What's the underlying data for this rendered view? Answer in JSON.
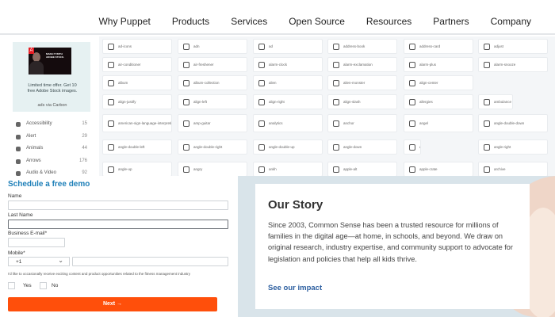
{
  "nav": {
    "items": [
      "Why Puppet",
      "Products",
      "Services",
      "Open Source",
      "Resources",
      "Partners",
      "Company"
    ]
  },
  "ad": {
    "image_caption": "MAKE IT WITH ADOBE STOCK.",
    "logo": "A",
    "text": "Limited time offer. Get 10 free Adobe Stock images.",
    "credit": "ads via Carbon",
    "close": "×"
  },
  "categories": [
    {
      "label": "Accessibility",
      "count": "15"
    },
    {
      "label": "Alert",
      "count": "29"
    },
    {
      "label": "Animals",
      "count": "44"
    },
    {
      "label": "Arrows",
      "count": "176"
    },
    {
      "label": "Audio & Video",
      "count": "92"
    }
  ],
  "icons": [
    "ad-icons",
    "adn",
    "ad",
    "address-book",
    "address-card",
    "adjust",
    "air-conditioner",
    "air-freshener",
    "alarm-clock",
    "alarm-exclamation",
    "alarm-plus",
    "alarm-snooze",
    "album",
    "album-collection",
    "alien",
    "alien-monster",
    "align-center",
    "align-justify",
    "align-left",
    "align-right",
    "align-slash",
    "allergies",
    "ambulance",
    "american-sign-language-interpreting",
    "amp-guitar",
    "analytics",
    "anchor",
    "angel",
    "angle-double-down",
    "angle-double-left",
    "angle-double-right",
    "angle-double-up",
    "angle-down",
    "angle-left",
    "angle-right",
    "angle-up",
    "angry",
    "ankh",
    "apple-alt",
    "apple-crate",
    "archive"
  ],
  "form": {
    "title": "Schedule a free demo",
    "name_label": "Name",
    "last_name_label": "Last Name",
    "email_label": "Business E-mail*",
    "mobile_label": "Mobile*",
    "country_code": "+1",
    "consent": "I'd like to occasionally receive exciting content and product opportunities related to the fitness management industry",
    "yes_label": "Yes",
    "no_label": "No",
    "next_label": "Next →"
  },
  "story": {
    "title": "Our Story",
    "body": "Since 2003, Common Sense has been a trusted resource for millions of families in the digital age—at home, in schools, and beyond. We draw on original research, industry expertise, and community support to advocate for legislation and policies that help all kids thrive.",
    "link": "See our impact"
  }
}
